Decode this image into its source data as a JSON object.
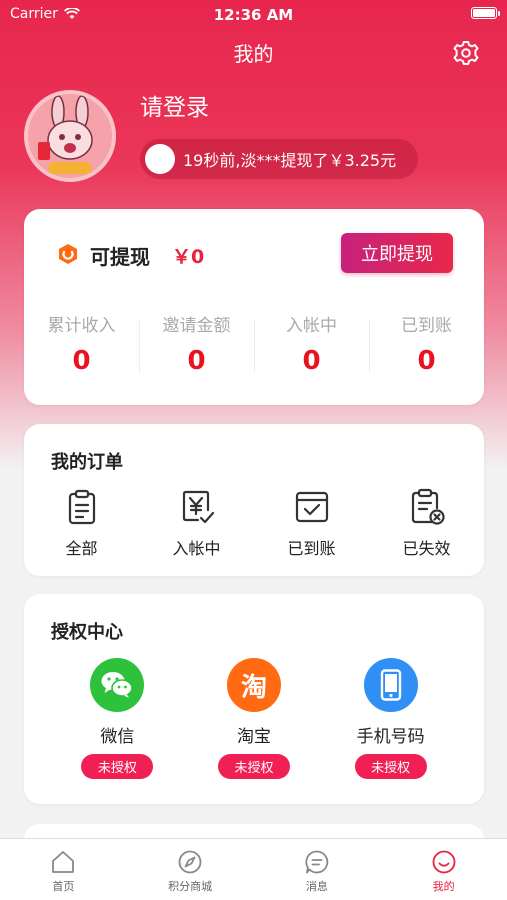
{
  "status_bar": {
    "carrier": "Carrier",
    "time": "12:36 AM"
  },
  "header": {
    "title": "我的",
    "settings_icon": "gear-icon"
  },
  "profile": {
    "login_text": "请登录",
    "ticker_text": "19秒前,淡***提现了￥3.25元",
    "avatar_icon": "rabbit-avatar-icon"
  },
  "wallet": {
    "label": "可提现",
    "amount": "￥0",
    "withdraw_button": "立即提现",
    "stats": [
      {
        "label": "累计收入",
        "value": "0"
      },
      {
        "label": "邀请金额",
        "value": "0"
      },
      {
        "label": "入帐中",
        "value": "0"
      },
      {
        "label": "已到账",
        "value": "0"
      }
    ]
  },
  "orders": {
    "title": "我的订单",
    "items": [
      {
        "label": "全部",
        "icon": "clipboard-icon"
      },
      {
        "label": "入帐中",
        "icon": "yen-check-icon"
      },
      {
        "label": "已到账",
        "icon": "tray-check-icon"
      },
      {
        "label": "已失效",
        "icon": "clipboard-x-icon"
      }
    ]
  },
  "auth": {
    "title": "授权中心",
    "items": [
      {
        "label": "微信",
        "badge": "未授权",
        "icon": "wechat-icon",
        "color": "#2ec13c"
      },
      {
        "label": "淘宝",
        "badge": "未授权",
        "icon": "taobao-icon",
        "glyph": "淘",
        "color": "#ff6a13"
      },
      {
        "label": "手机号码",
        "badge": "未授权",
        "icon": "phone-icon",
        "color": "#2f8ff5"
      }
    ]
  },
  "tab_bar": {
    "tabs": [
      {
        "label": "首页",
        "icon": "home-icon"
      },
      {
        "label": "积分商城",
        "icon": "compass-icon"
      },
      {
        "label": "消息",
        "icon": "message-icon"
      },
      {
        "label": "我的",
        "icon": "smile-icon",
        "active": true
      }
    ],
    "accent": "#e8213d"
  }
}
